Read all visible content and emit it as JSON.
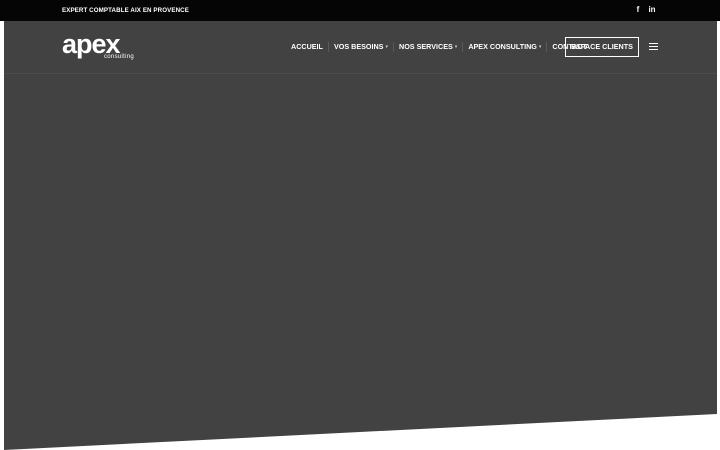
{
  "topbar": {
    "tagline": "EXPERT COMPTABLE AIX EN PROVENCE",
    "social": [
      {
        "icon": "facebook-icon",
        "glyph": "f"
      },
      {
        "icon": "linkedin-icon",
        "glyph": "in"
      }
    ]
  },
  "header": {
    "logo": {
      "word": "apex",
      "sub": "consulting"
    },
    "nav": [
      {
        "label": "ACCUEIL",
        "has_dropdown": false
      },
      {
        "label": "VOS BESOINS",
        "has_dropdown": true
      },
      {
        "label": "NOS SERVICES",
        "has_dropdown": true
      },
      {
        "label": "APEX CONSULTING",
        "has_dropdown": true
      },
      {
        "label": "CONTACT",
        "has_dropdown": false
      }
    ],
    "client_button": "ESPACE CLIENTS",
    "menu_icon": "hamburger-menu-icon"
  },
  "colors": {
    "topbar": "#050505",
    "hero": "#424242",
    "text": "#ffffff"
  }
}
